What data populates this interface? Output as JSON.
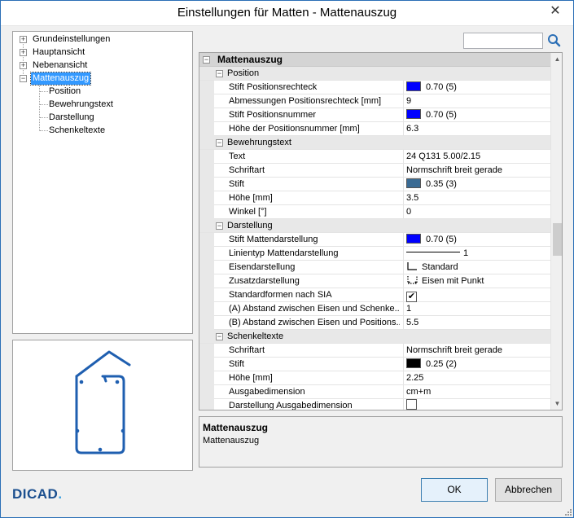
{
  "window": {
    "title": "Einstellungen für Matten - Mattenauszug",
    "close_glyph": "✕"
  },
  "tree": {
    "items": [
      {
        "label": "Grundeinstellungen",
        "toggle": "+"
      },
      {
        "label": "Hauptansicht",
        "toggle": "+"
      },
      {
        "label": "Nebenansicht",
        "toggle": "+"
      },
      {
        "label": "Mattenauszug",
        "toggle": "−",
        "selected": true
      },
      {
        "label": "Position"
      },
      {
        "label": "Bewehrungstext"
      },
      {
        "label": "Darstellung"
      },
      {
        "label": "Schenkeltexte"
      }
    ]
  },
  "search": {
    "value": "",
    "placeholder": "",
    "icon": "magnifier-icon"
  },
  "grid": {
    "header": "Mattenauszug",
    "categories": [
      {
        "name": "Position",
        "rows": [
          {
            "label": "Stift Positionsrechteck",
            "type": "pen",
            "color": "#0000ff",
            "value": "0.70 (5)"
          },
          {
            "label": "Abmessungen Positionsrechteck [mm]",
            "type": "text",
            "value": "9"
          },
          {
            "label": "Stift Positionsnummer",
            "type": "pen",
            "color": "#0000ff",
            "value": "0.70 (5)"
          },
          {
            "label": "Höhe der Positionsnummer [mm]",
            "type": "text",
            "value": "6.3"
          }
        ]
      },
      {
        "name": "Bewehrungstext",
        "rows": [
          {
            "label": "Text",
            "type": "text",
            "value": "24 Q131 5.00/2.15"
          },
          {
            "label": "Schriftart",
            "type": "text",
            "value": "Normschrift breit gerade"
          },
          {
            "label": "Stift",
            "type": "pen",
            "color": "#3a6b94",
            "value": "0.35 (3)"
          },
          {
            "label": "Höhe [mm]",
            "type": "text",
            "value": "3.5"
          },
          {
            "label": "Winkel [°]",
            "type": "text",
            "value": "0"
          }
        ]
      },
      {
        "name": "Darstellung",
        "rows": [
          {
            "label": "Stift Mattendarstellung",
            "type": "pen",
            "color": "#0000ff",
            "value": "0.70 (5)"
          },
          {
            "label": "Linientyp Mattendarstellung",
            "type": "linetype",
            "value": "1"
          },
          {
            "label": "Eisendarstellung",
            "type": "iron",
            "value": "Standard"
          },
          {
            "label": "Zusatzdarstellung",
            "type": "ironpoint",
            "value": "Eisen mit Punkt"
          },
          {
            "label": "Standardformen nach SIA",
            "type": "check",
            "checked": true,
            "value": "✔"
          },
          {
            "label": "(A) Abstand zwischen Eisen und Schenke...",
            "type": "text",
            "value": "1"
          },
          {
            "label": "(B) Abstand zwischen Eisen und Positions...",
            "type": "text",
            "value": "5.5"
          }
        ]
      },
      {
        "name": "Schenkeltexte",
        "rows": [
          {
            "label": "Schriftart",
            "type": "text",
            "value": "Normschrift breit gerade"
          },
          {
            "label": "Stift",
            "type": "pen",
            "color": "#000000",
            "value": "0.25 (2)"
          },
          {
            "label": "Höhe [mm]",
            "type": "text",
            "value": "2.25"
          },
          {
            "label": "Ausgabedimension",
            "type": "text",
            "value": "cm+m"
          },
          {
            "label": "Darstellung Ausgabedimension",
            "type": "check",
            "checked": false,
            "value": ""
          }
        ]
      }
    ]
  },
  "description": {
    "title": "Mattenauszug",
    "text": "Mattenauszug"
  },
  "footer": {
    "logo": "DICAD",
    "ok_label": "OK",
    "cancel_label": "Abbrechen"
  },
  "colors": {
    "accent": "#3399ff",
    "rebar": "#1f5fb0"
  }
}
